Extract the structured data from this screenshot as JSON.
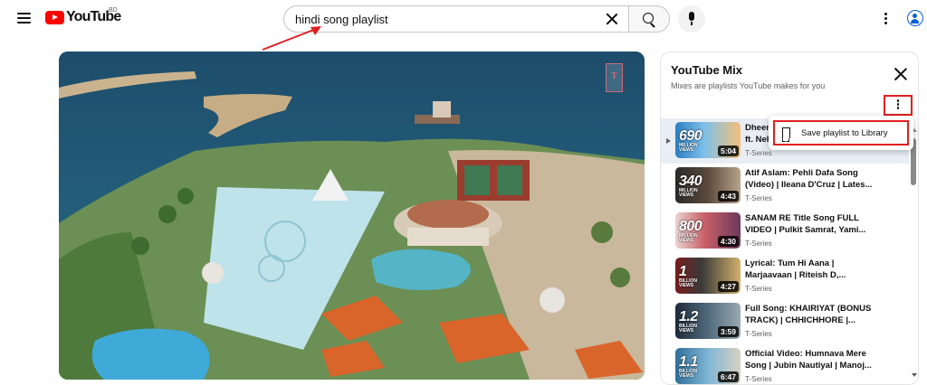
{
  "header": {
    "logo_text": "YouTube",
    "country_code": "BD",
    "search_value": "hindi song playlist"
  },
  "mix": {
    "title": "YouTube Mix",
    "subtitle": "Mixes are playlists YouTube makes for you",
    "menu_option": "Save playlist to Library",
    "items": [
      {
        "title": "Dheeme Dheeme | Tony Kakkar ft. Neha Sharma | Official Music Video",
        "title_visible": "Dheer\nVideo",
        "channel": "T-Series",
        "duration": "5:04",
        "badge_number": "690",
        "badge_text": "MILLION\nVIEWS",
        "active": true
      },
      {
        "title": "Atif Aslam: Pehli Dafa Song (Video) | Ileana D'Cruz | Lates...",
        "channel": "T-Series",
        "duration": "4:43",
        "badge_number": "340",
        "badge_text": "MILLION\nVIEWS"
      },
      {
        "title": "SANAM RE Title Song FULL VIDEO | Pulkit Samrat, Yami...",
        "channel": "T-Series",
        "duration": "4:30",
        "badge_number": "800",
        "badge_text": "MILLION\nVIEWS"
      },
      {
        "title": "Lyrical: Tum Hi Aana | Marjaavaan | Riteish D,...",
        "channel": "T-Series",
        "duration": "4:27",
        "badge_number": "1",
        "badge_text": "BILLION\nVIEWS"
      },
      {
        "title": "Full Song: KHAIRIYAT (BONUS TRACK) | CHHICHHORE |...",
        "channel": "T-Series",
        "duration": "3:59",
        "badge_number": "1.2",
        "badge_text": "BILLION\nVIEWS"
      },
      {
        "title": "Official Video: Humnava Mere Song | Jubin Nautiyal | Manoj...",
        "channel": "T-Series",
        "duration": "6:47",
        "badge_number": "1.1",
        "badge_text": "BILLION\nVIEWS"
      }
    ]
  },
  "player": {
    "watermark": "T"
  },
  "colors": {
    "brand_red": "#ff0000",
    "annotation_red": "#e02020",
    "link_blue": "#065fd4"
  }
}
